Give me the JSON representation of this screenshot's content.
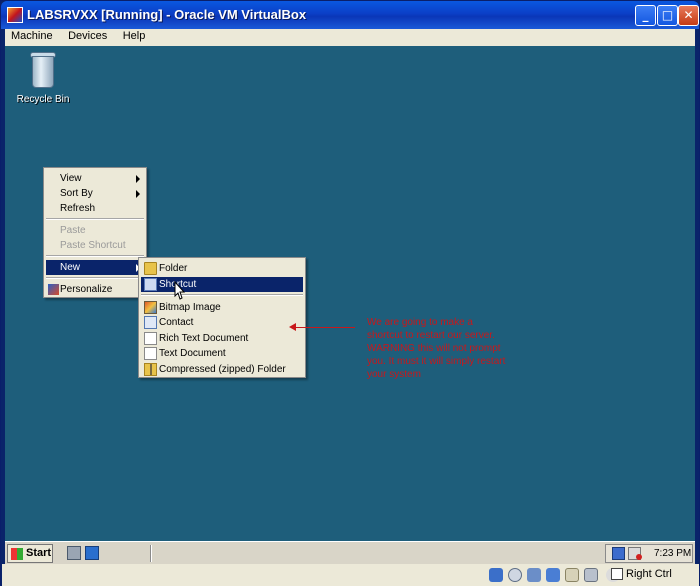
{
  "window": {
    "title": "LABSRVXX [Running] - Oracle VM VirtualBox",
    "controls": [
      "minimize",
      "maximize",
      "close"
    ]
  },
  "menubar": {
    "items": [
      "Machine",
      "Devices",
      "Help"
    ]
  },
  "desktop": {
    "background": "#1e5e7b",
    "icons": [
      {
        "label": "Recycle Bin",
        "icon": "recycle-bin-icon"
      }
    ]
  },
  "context_menu": {
    "items": [
      {
        "label": "View",
        "has_submenu": true
      },
      {
        "label": "Sort By",
        "has_submenu": true
      },
      {
        "label": "Refresh"
      },
      {
        "label": "Paste",
        "disabled": true
      },
      {
        "label": "Paste Shortcut",
        "disabled": true
      },
      {
        "label": "New",
        "has_submenu": true,
        "highlighted": true
      },
      {
        "label": "Personalize",
        "icon": "personalize-icon"
      }
    ]
  },
  "new_submenu": {
    "items": [
      {
        "label": "Folder",
        "icon": "folder-icon"
      },
      {
        "label": "Shortcut",
        "icon": "shortcut-icon",
        "highlighted": true
      },
      {
        "label": "Bitmap Image",
        "icon": "bitmap-icon"
      },
      {
        "label": "Contact",
        "icon": "contact-icon"
      },
      {
        "label": "Rich Text Document",
        "icon": "rtf-icon"
      },
      {
        "label": "Text Document",
        "icon": "text-doc-icon"
      },
      {
        "label": "Compressed (zipped) Folder",
        "icon": "zip-folder-icon"
      }
    ]
  },
  "annotation": {
    "text": "We are going to make a shortcut to restart our server. WARNING this will not prompt you. It must it will simply restart your system",
    "color": "#c8181b"
  },
  "taskbar": {
    "start_label": "Start",
    "clock": "7:23 PM"
  },
  "statusbar": {
    "host_key_label": "Right Ctrl"
  }
}
